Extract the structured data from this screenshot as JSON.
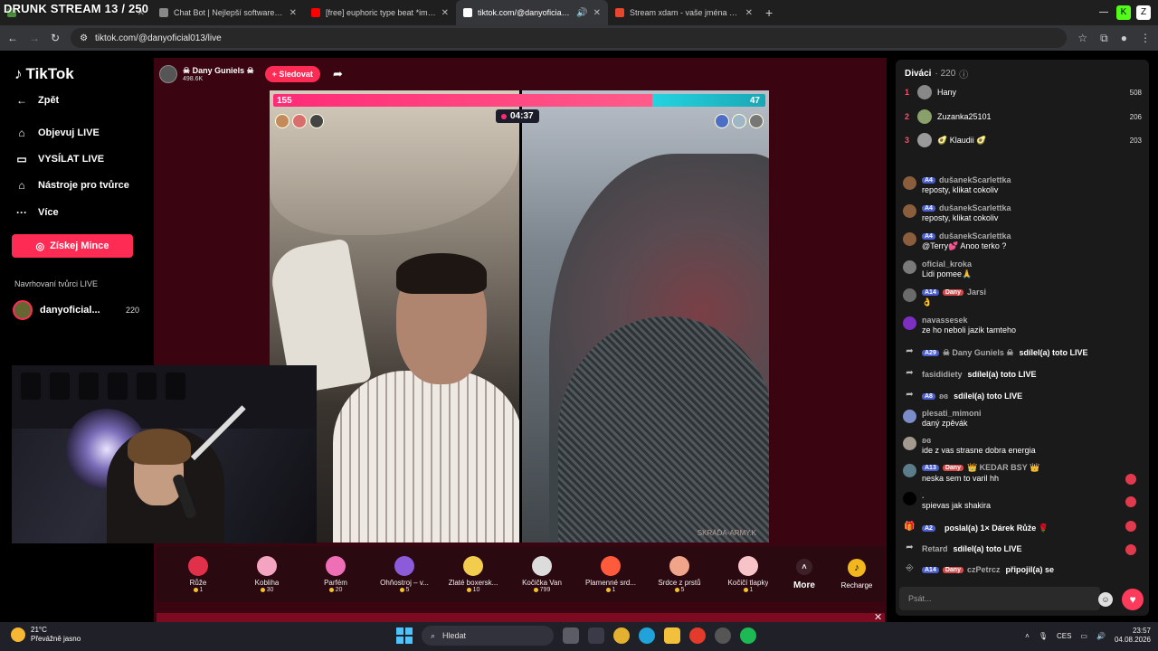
{
  "stream_overlay_title": "DRUNK STREAM 13 / 250",
  "tabs": [
    {
      "title": "",
      "color": "#4a8f3c"
    },
    {
      "title": "Chat Bot | Nejlepší software pro",
      "color": "#888888"
    },
    {
      "title": "[free] euphoric type beat *impu",
      "color": "#ff0000"
    },
    {
      "title": "tiktok.com/@danyoficial013",
      "color": "#ffffff",
      "active": true
    },
    {
      "title": "Stream xdam - vaše jména (stre",
      "color": "#e8462c"
    }
  ],
  "address": {
    "url": "tiktok.com/@danyoficial013/live"
  },
  "sidebar": {
    "logo": "TikTok",
    "back": "Zpět",
    "items": [
      {
        "label": "Objevuj LIVE",
        "icon": "⌂"
      },
      {
        "label": "VYSÍLAT LIVE",
        "icon": "▭"
      },
      {
        "label": "Nástroje pro tvůrce",
        "icon": "⌂"
      },
      {
        "label": "Více",
        "icon": "···"
      }
    ],
    "coins_button": "Získej Mince",
    "suggested_title": "Navrhovaní tvůrci LIVE",
    "creator": {
      "name": "danyoficial...",
      "count": "220"
    }
  },
  "live": {
    "host_name": "☠ Dany Guniels ☠",
    "host_likes": "498.6K",
    "follow_label": "+ Sledovat",
    "battle_left": "155",
    "battle_right": "47",
    "battle_left_share": 0.77,
    "timer": "04:37",
    "watermark": "SKRÁĎA-ARMY.K"
  },
  "gifts": [
    {
      "name": "Růže",
      "price": "1",
      "color": "#e0304a"
    },
    {
      "name": "Kobliha",
      "price": "30",
      "color": "#f4a3c0"
    },
    {
      "name": "Parfém",
      "price": "20",
      "color": "#ee6fb6"
    },
    {
      "name": "Ohňostroj – v...",
      "price": "5",
      "color": "#8b5bd9"
    },
    {
      "name": "Zlaté boxersk...",
      "price": "10",
      "color": "#f2cc4c"
    },
    {
      "name": "Kočička Van",
      "price": "799",
      "color": "#dcdcdc"
    },
    {
      "name": "Plamenné srd...",
      "price": "1",
      "color": "#ff5a3c"
    },
    {
      "name": "Srdce z prstů",
      "price": "5",
      "color": "#f0a58a"
    },
    {
      "name": "Kočičí tlapky",
      "price": "1",
      "color": "#f7c3c9"
    }
  ],
  "gift_more": "More",
  "recharge": "Recharge",
  "viewers": {
    "title": "Diváci",
    "count": "· 220",
    "top": [
      {
        "rank": "1",
        "name": "Hany",
        "score": "508"
      },
      {
        "rank": "2",
        "name": "Zuzanka25101",
        "score": "206"
      },
      {
        "rank": "3",
        "name": "🥑 Klaudii 🥑",
        "score": "203"
      }
    ]
  },
  "chat": [
    {
      "user": "dušanekScarlettka",
      "lvl": "4",
      "text": "reposty, klikat cokoliv"
    },
    {
      "user": "dušanekScarlettka",
      "lvl": "4",
      "text": "reposty, klikat cokoliv"
    },
    {
      "user": "dušanekScarlettka",
      "lvl": "4",
      "text": "@Terry💕 Anoo terko ?"
    },
    {
      "user": "oficial_kroka",
      "text": "Lidi pomee🙏"
    },
    {
      "user": "Jarsi",
      "lvl": "14",
      "badge": "Dany",
      "text": "👌"
    },
    {
      "user": "navassesek",
      "text": "ze ho neboli jazik tamteho"
    },
    {
      "user": "☠ Dany Guniels ☠",
      "lvl": "29",
      "inline": "sdílel(a) toto LIVE",
      "share": true
    },
    {
      "user": "fasididiety",
      "inline": "sdílel(a) toto LIVE",
      "share": true
    },
    {
      "user": "ʚɞ",
      "lvl": "8",
      "inline": "sdílel(a) toto LIVE",
      "share": true
    },
    {
      "user": "plesati_mimoni",
      "text": "daný zpěvák"
    },
    {
      "user": "ʚɞ",
      "text": "ide z vas strasne dobra energia"
    },
    {
      "user": "👑 KEDAR BSY 👑",
      "lvl": "13",
      "badge": "Dany",
      "text": "neska sem to varil hh"
    },
    {
      "user": ".",
      "text": "spievas jak shakira"
    },
    {
      "user": "",
      "lvl": "2",
      "inline": "poslal(a) 1× Dárek Růže 🌹",
      "share": true
    },
    {
      "user": "Retard",
      "inline": "sdílel(a) toto LIVE",
      "share": true
    },
    {
      "user": "czPetrcz",
      "lvl": "14",
      "badge": "Dany",
      "inline": "připojil(a) se",
      "share": true
    }
  ],
  "chat_input_placeholder": "Psát...",
  "taskbar": {
    "temp": "21°C",
    "weather": "Převážně jasno",
    "search": "Hledat",
    "lang": "CES",
    "time": "23:57",
    "date": "04.08.2026"
  }
}
